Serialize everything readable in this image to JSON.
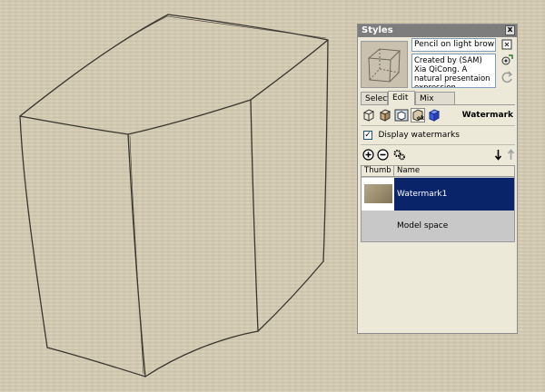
{
  "panel": {
    "title": "Styles",
    "close_label": "x",
    "style_name": "Pencil on light brown",
    "style_description": "Created by (SAM) Xia QiCong.   A natural presentaion expression"
  },
  "tabs": [
    {
      "label": "Select"
    },
    {
      "label": "Edit"
    },
    {
      "label": "Mix"
    }
  ],
  "edit": {
    "section_title": "Watermark",
    "display_watermarks_label": "Display watermarks",
    "display_watermarks_checked": true,
    "check_glyph": "✓"
  },
  "list": {
    "columns": [
      "Thumb",
      "Name"
    ],
    "rows": [
      {
        "name": "Watermark1",
        "selected": true
      },
      {
        "name": "Model space"
      }
    ]
  },
  "colors": {
    "canvas": "#d6cdb3",
    "panel_bg": "#ece9d8",
    "selection": "#0a246a"
  }
}
